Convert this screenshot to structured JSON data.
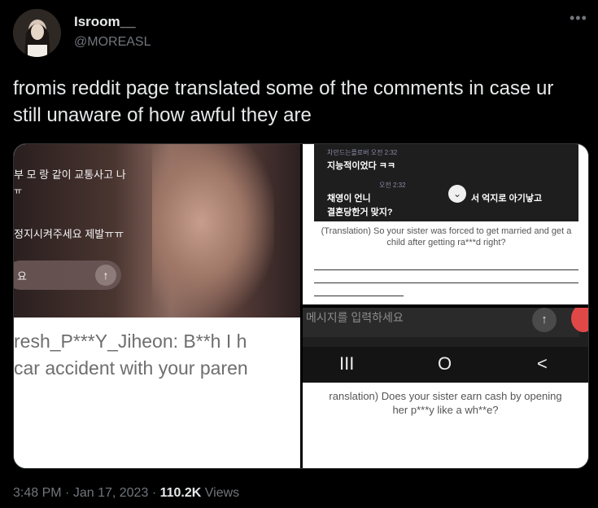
{
  "author": {
    "display_name": "Isroom__",
    "handle": "@MOREASL"
  },
  "more_icon": "more-horizontal-icon",
  "tweet": {
    "text": "fromis reddit page translated some of the comments in case ur still unaware of how awful they are"
  },
  "media": {
    "left": {
      "overlay_lines": [
        "부 모 랑 같이 교통사고 나",
        "ㅠ",
        "정지시켜주세요 제발ㅠㅠ"
      ],
      "input_placeholder": "요",
      "caption_line1": "resh_P***Y_Jiheon: B**h I h",
      "caption_line2": "car accident with your paren"
    },
    "top_right": {
      "meta1": "차만드는플로버 오전 2:32",
      "kr1": "지능적이었다 ㅋㅋ",
      "meta2": "오전 2:32",
      "kr2a": "채영이 언니",
      "kr2b": "서 억지로 아기낳고",
      "kr3": "결혼당한거 맞지?",
      "translation": "(Translation) So your sister was forced to get married and get a child after getting ra***d right?"
    },
    "bottom_right": {
      "input_placeholder": "메시지를 입력하세요",
      "nav_recent": "III",
      "nav_home": "O",
      "nav_back": "<",
      "translation_line1": "ranslation) Does your sister earn cash by opening",
      "translation_line2": "her p***y like a wh**e?"
    }
  },
  "meta": {
    "time": "3:48 PM",
    "sep": "·",
    "date": "Jan 17, 2023",
    "views_count": "110.2K",
    "views_label": "Views"
  }
}
